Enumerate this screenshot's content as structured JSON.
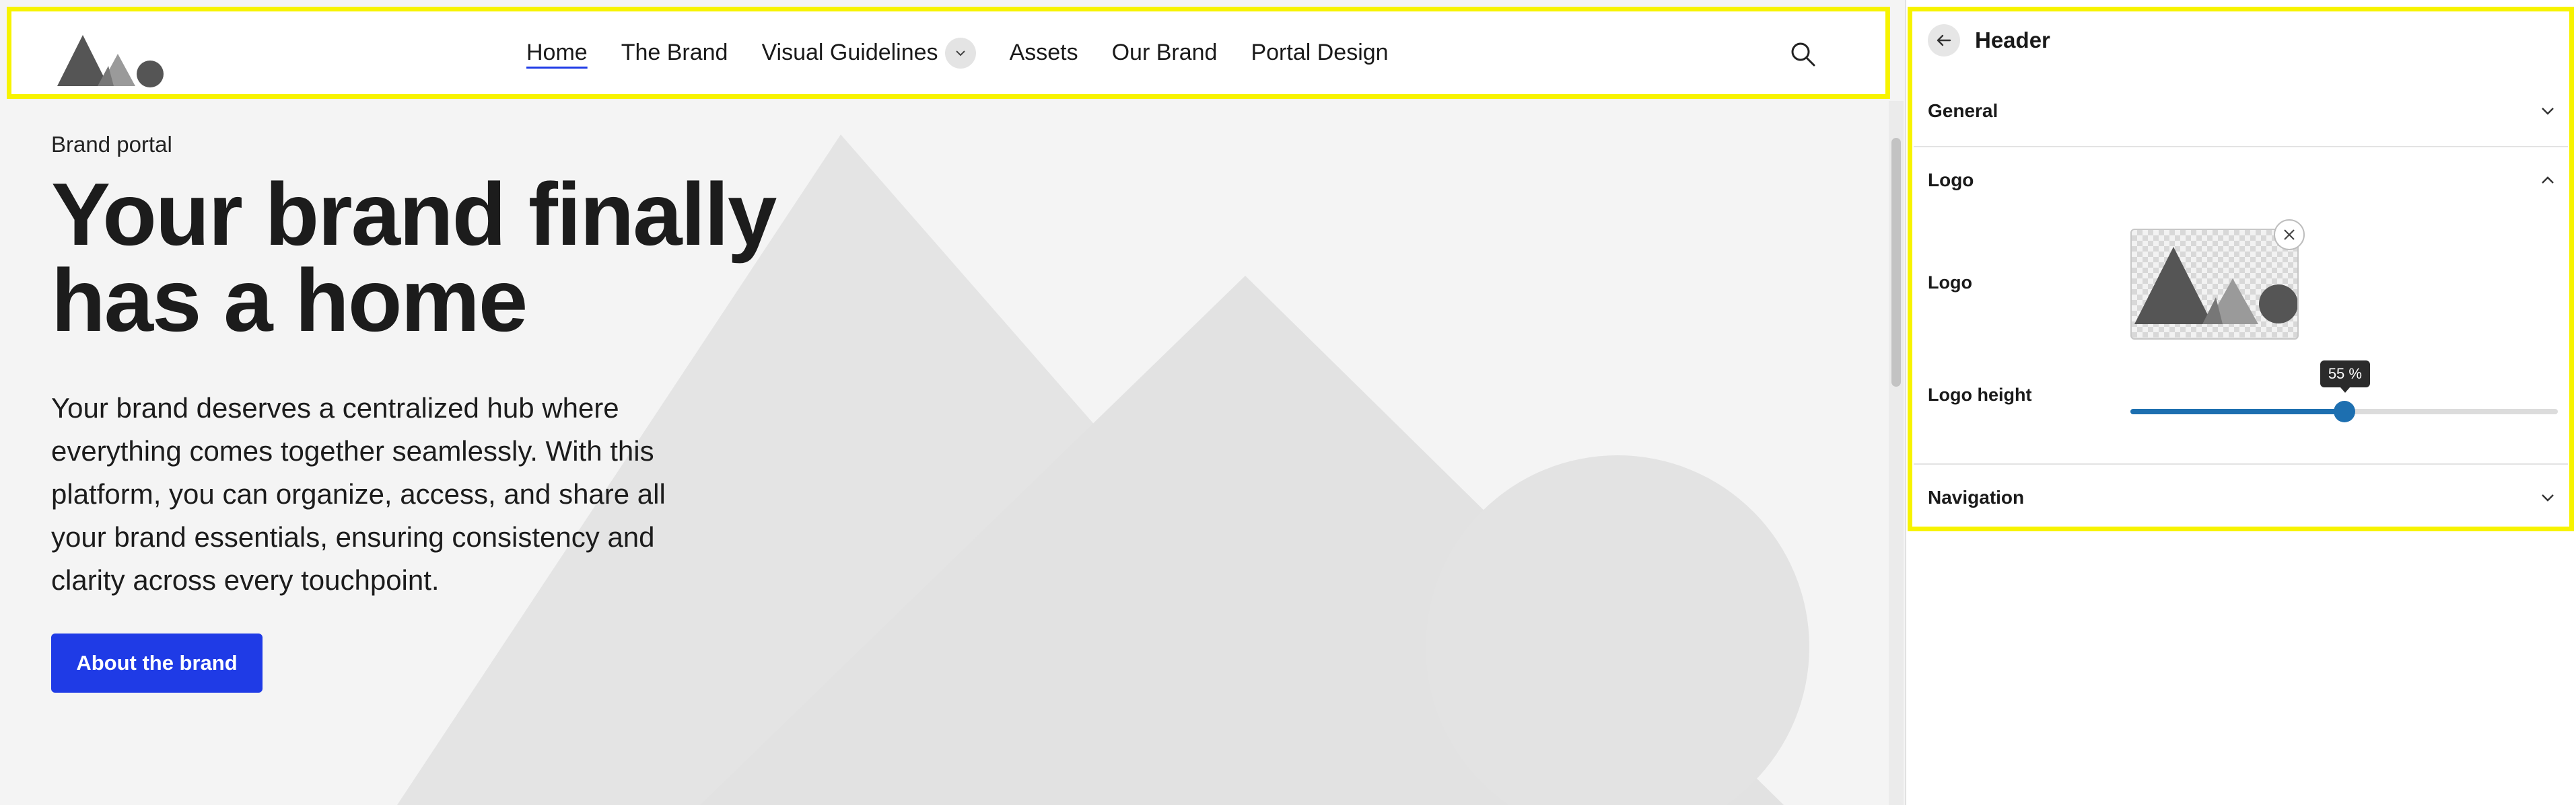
{
  "site": {
    "nav": [
      {
        "label": "Home",
        "active": true
      },
      {
        "label": "The Brand"
      },
      {
        "label": "Visual Guidelines",
        "has_dropdown": true
      },
      {
        "label": "Assets"
      },
      {
        "label": "Our Brand"
      },
      {
        "label": "Portal Design"
      }
    ],
    "search_icon": "search-icon"
  },
  "hero": {
    "eyebrow": "Brand portal",
    "title_line1": "Your brand finally",
    "title_line2": "has a home",
    "body": "Your brand deserves a centralized hub where everything comes together seamlessly. With this platform, you can organize, access, and share all your brand essentials, ensuring consistency and clarity across every touchpoint.",
    "button_label": "About the brand"
  },
  "panel": {
    "title": "Header",
    "sections": {
      "general": "General",
      "logo": "Logo",
      "navigation": "Navigation"
    },
    "logo_field_label": "Logo",
    "logo_height_label": "Logo height",
    "logo_height_value": 55,
    "logo_height_text": "55 %"
  },
  "colors": {
    "accent": "#1f3be6",
    "slider": "#1d6fb0",
    "highlight": "#f7f300",
    "hero_shapes": "#e3e3e3"
  }
}
